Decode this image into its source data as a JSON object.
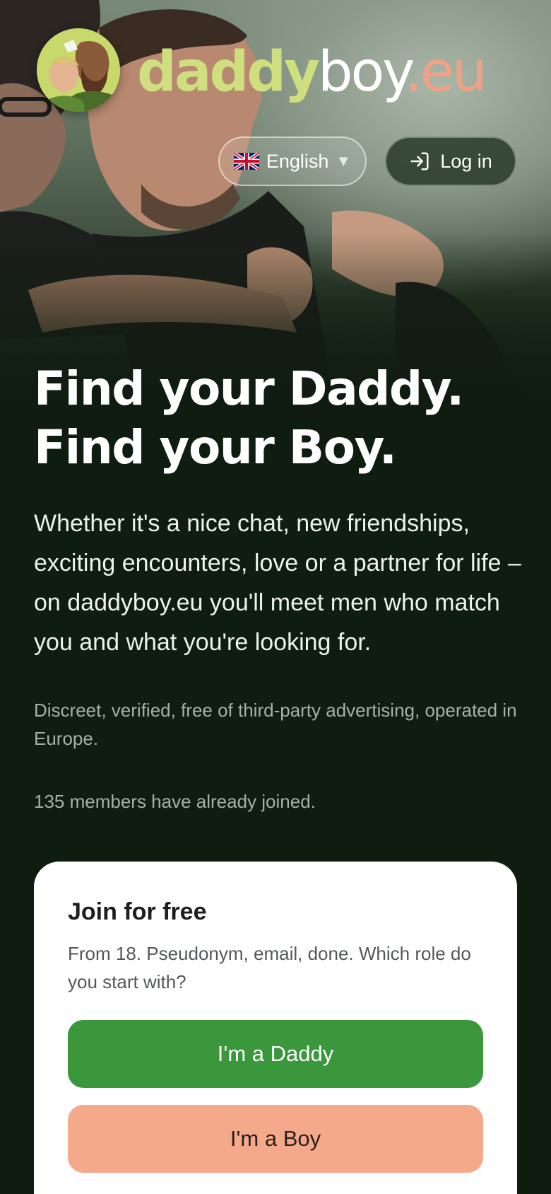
{
  "brand": {
    "logo_parts": {
      "daddy": "daddy",
      "boy": "boy",
      "eu": ".eu"
    },
    "colors": {
      "daddy": "#cfdf7f",
      "boy": "#ffffff",
      "eu": "#f2a187",
      "background": "#0f1c10"
    }
  },
  "header": {
    "language": {
      "label": "English",
      "flag_icon": "uk-flag-icon",
      "caret_icon": "caret-down-icon"
    },
    "login": {
      "label": "Log in",
      "icon": "login-arrow-icon"
    }
  },
  "hero": {
    "headline_line1": "Find your Daddy.",
    "headline_line2": "Find your Boy.",
    "lead": "Whether it's a nice chat, new friendships, exciting encounters, love or a partner for life – on daddyboy.eu you'll meet men who match you and what you're looking for.",
    "trust": "Discreet, verified, free of third-party advertising, operated in Europe.",
    "members": "135 members have already joined."
  },
  "signup": {
    "title": "Join for free",
    "subtitle": "From 18. Pseudonym, email, done. Which role do you start with?",
    "daddy_button": "I'm a Daddy",
    "boy_button": "I'm a Boy",
    "colors": {
      "daddy_button": "#3a973c",
      "boy_button": "#f4a98a"
    }
  }
}
